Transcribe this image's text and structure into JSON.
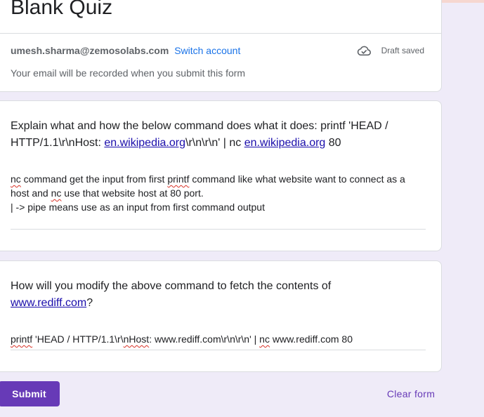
{
  "form": {
    "title": "Blank Quiz",
    "account_email": "umesh.sharma@zemosolabs.com",
    "switch_account": "Switch account",
    "draft_status": "Draft saved",
    "email_note": "Your email will be recorded when you submit this form"
  },
  "questions": [
    {
      "text_parts": [
        "Explain what and how the below command does what it does: printf 'HEAD / HTTP/1.1\\r\\nHost: ",
        "en.wikipedia.org",
        "\\r\\n\\r\\n' | nc ",
        "en.wikipedia.org",
        " 80"
      ],
      "answer_lines": [
        [
          "nc",
          " command get the input from first ",
          "printf",
          " command like what website want to connect as a"
        ],
        [
          "host and ",
          "nc",
          " use that website host at 80 port."
        ],
        [
          "| -> pipe means use as an input from first command output"
        ]
      ]
    },
    {
      "text_parts": [
        "How will you modify the above command to fetch the contents of ",
        "www.rediff.com",
        "?"
      ],
      "answer_parts": [
        "printf",
        " 'HEAD / HTTP/1.1\\r\\",
        "nHost",
        ": www.rediff.com\\r\\n\\r\\n' | ",
        "nc",
        " www.rediff.com 80"
      ]
    }
  ],
  "actions": {
    "submit": "Submit",
    "clear": "Clear form"
  },
  "icons": {
    "draft": "cloud-check-icon"
  },
  "colors": {
    "accent": "#673ab7",
    "link": "#1a0dab",
    "account_link": "#1a73e8",
    "background": "#efebf8"
  }
}
